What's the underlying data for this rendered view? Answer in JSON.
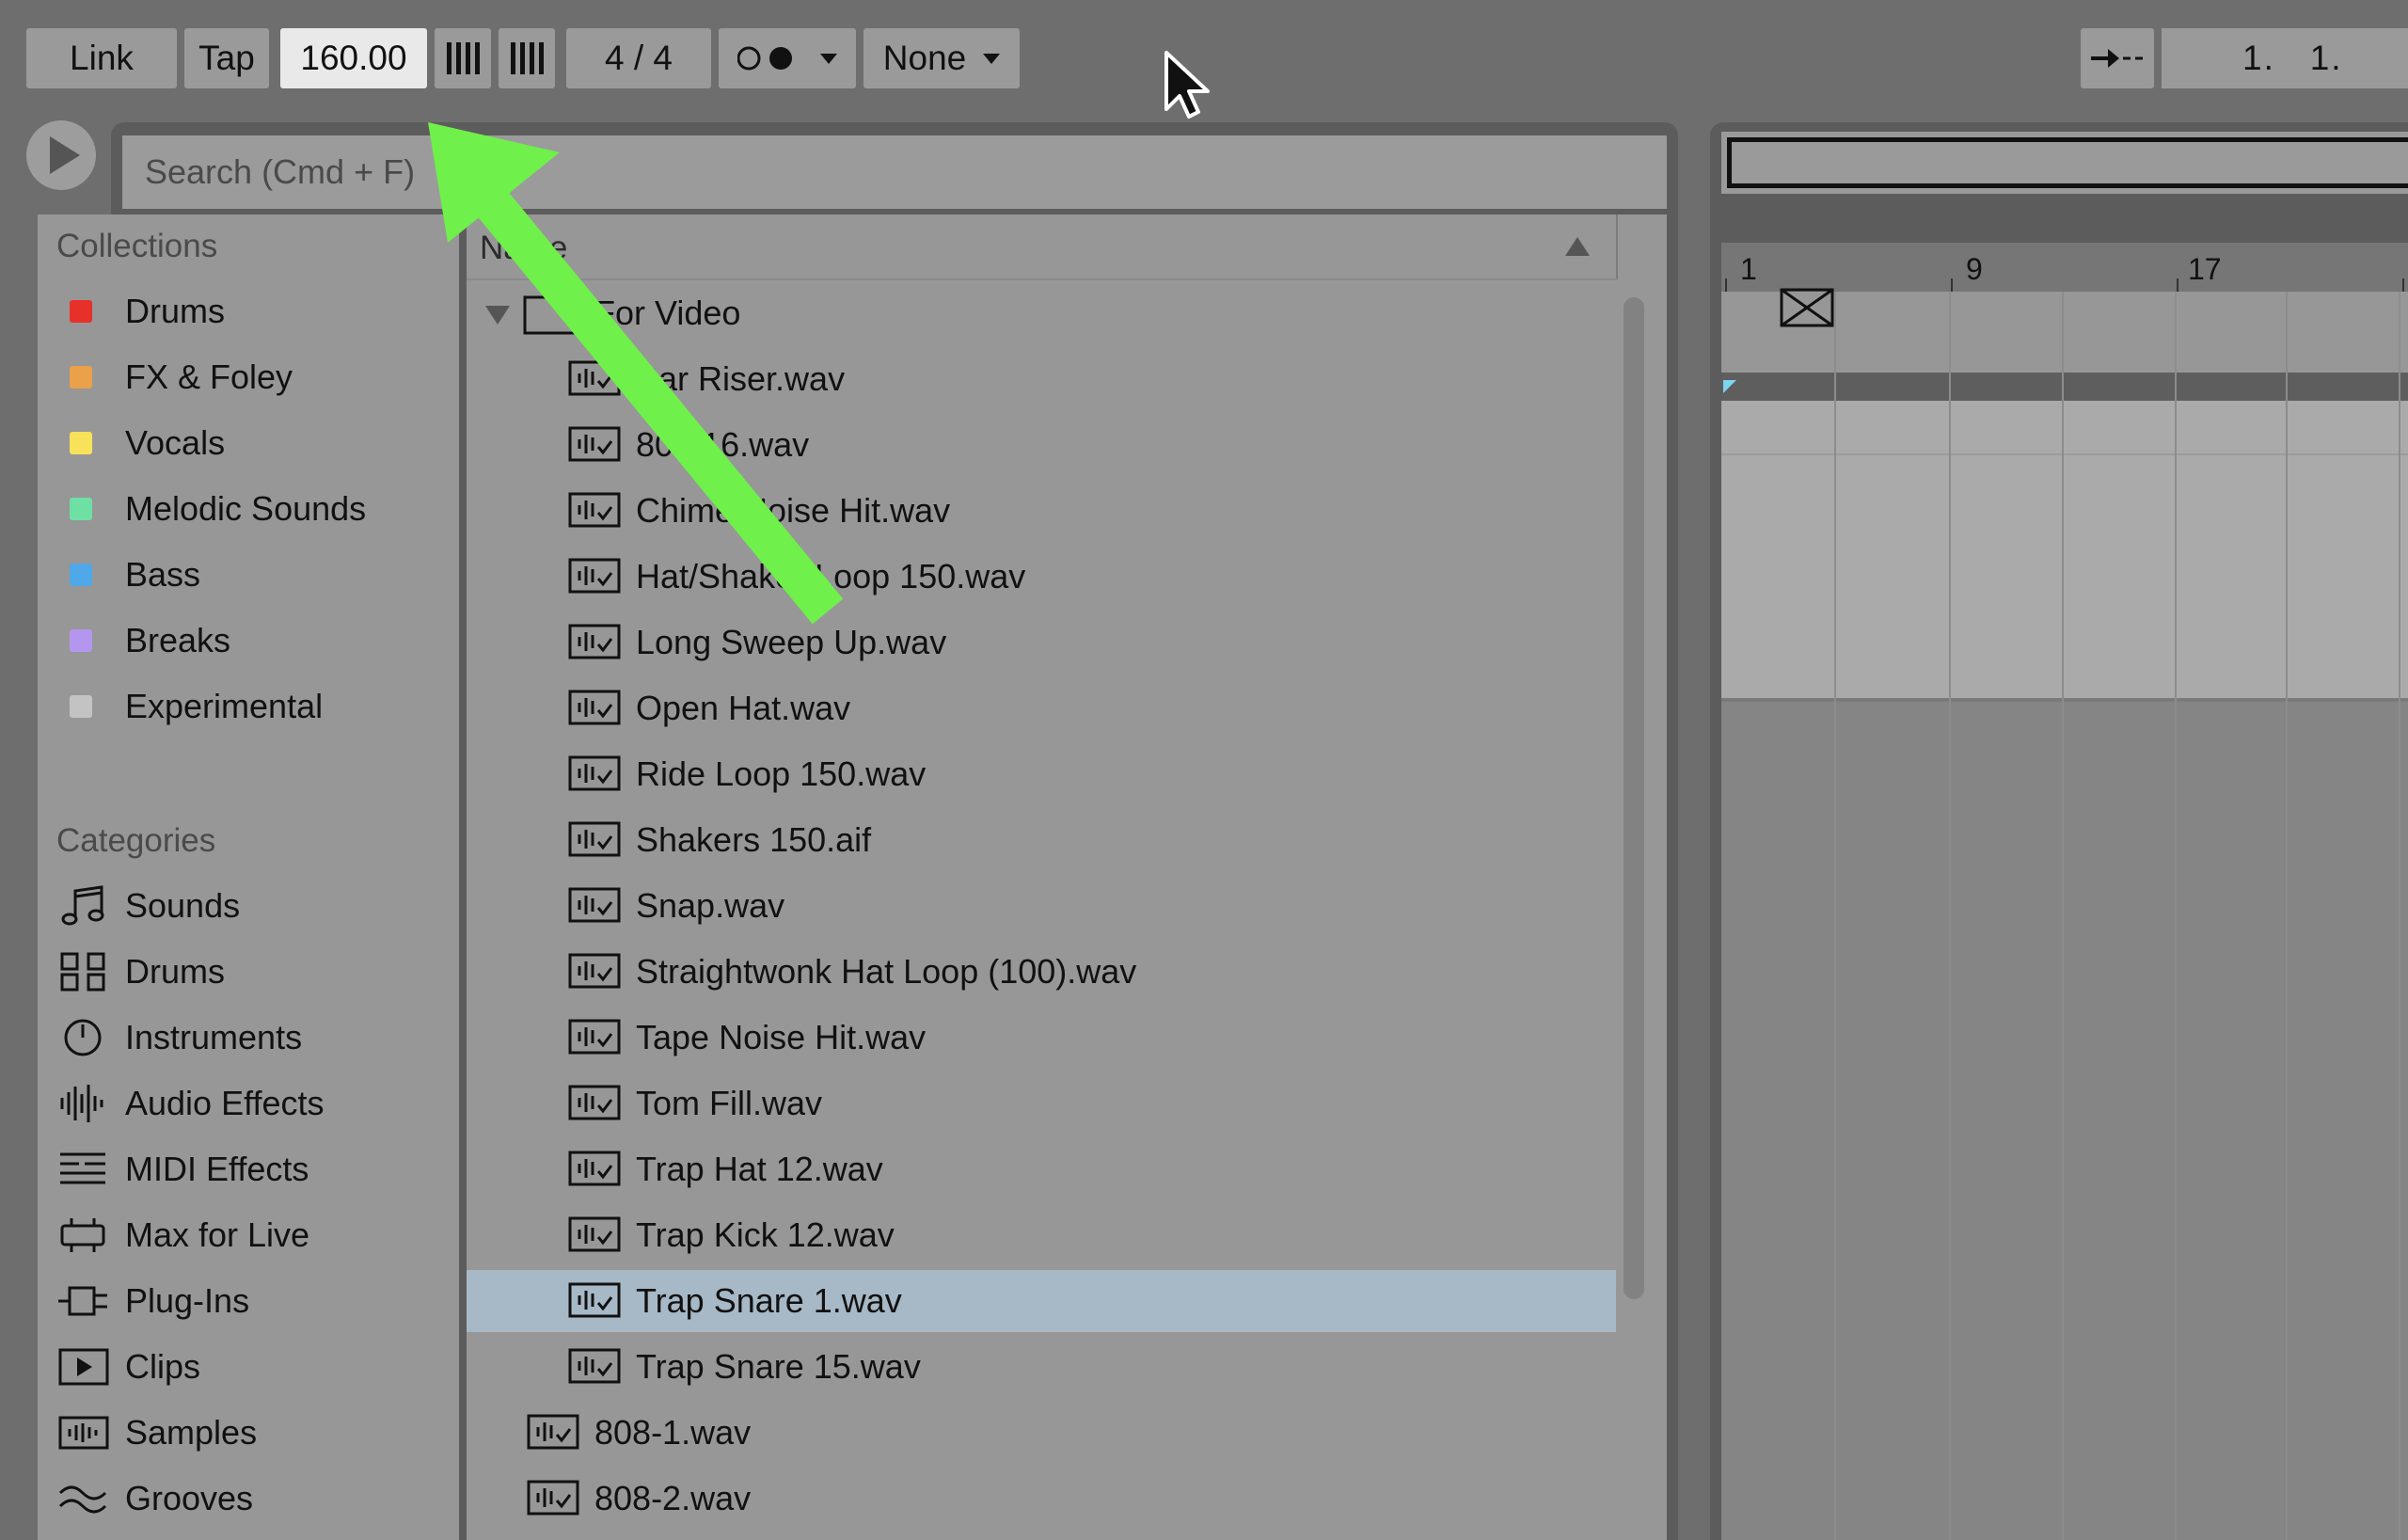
{
  "transport": {
    "link": "Link",
    "tap": "Tap",
    "tempo": "160.00",
    "time_signature": "4 / 4",
    "quantize": "None",
    "position": "1.   1."
  },
  "search": {
    "placeholder": "Search (Cmd + F)"
  },
  "collections": {
    "title": "Collections",
    "items": [
      {
        "label": "Drums",
        "color": "#e8302a"
      },
      {
        "label": "FX & Foley",
        "color": "#eba04a"
      },
      {
        "label": "Vocals",
        "color": "#f7e25a"
      },
      {
        "label": "Melodic Sounds",
        "color": "#6ee0a4"
      },
      {
        "label": "Bass",
        "color": "#4fa8e8"
      },
      {
        "label": "Breaks",
        "color": "#b596ee"
      },
      {
        "label": "Experimental",
        "color": "#c3c3c3"
      }
    ]
  },
  "categories": {
    "title": "Categories",
    "items": [
      {
        "label": "Sounds",
        "icon": "note-icon"
      },
      {
        "label": "Drums",
        "icon": "drum-grid-icon"
      },
      {
        "label": "Instruments",
        "icon": "clock-icon"
      },
      {
        "label": "Audio Effects",
        "icon": "waveform-icon"
      },
      {
        "label": "MIDI Effects",
        "icon": "midi-lines-icon"
      },
      {
        "label": "Max for Live",
        "icon": "max-icon"
      },
      {
        "label": "Plug-Ins",
        "icon": "plug-icon"
      },
      {
        "label": "Clips",
        "icon": "clip-play-icon"
      },
      {
        "label": "Samples",
        "icon": "sample-icon"
      },
      {
        "label": "Grooves",
        "icon": "groove-icon"
      }
    ]
  },
  "file_list": {
    "column_name": "Name",
    "folder": "For Video",
    "files": [
      "Bar Riser.wav",
      "808 16.wav",
      "Chime Noise Hit.wav",
      "Hat/Shaker Loop 150.wav",
      "Long Sweep Up.wav",
      "Open Hat.wav",
      "Ride Loop 150.wav",
      "Shakers 150.aif",
      "Snap.wav",
      "Straightwonk Hat Loop (100).wav",
      "Tape Noise Hit.wav",
      "Tom Fill.wav",
      "Trap Hat 12.wav",
      "Trap Kick 12.wav",
      "Trap Snare 1.wav",
      "Trap Snare 15.wav"
    ],
    "selected": "Trap Snare 1.wav",
    "root_files": [
      "808-1.wav",
      "808-2.wav"
    ]
  },
  "arrangement": {
    "ruler": [
      "1",
      "9",
      "17"
    ]
  },
  "colors": {
    "annotation_arrow": "#6ff04a",
    "selection": "#a7b8c6"
  }
}
